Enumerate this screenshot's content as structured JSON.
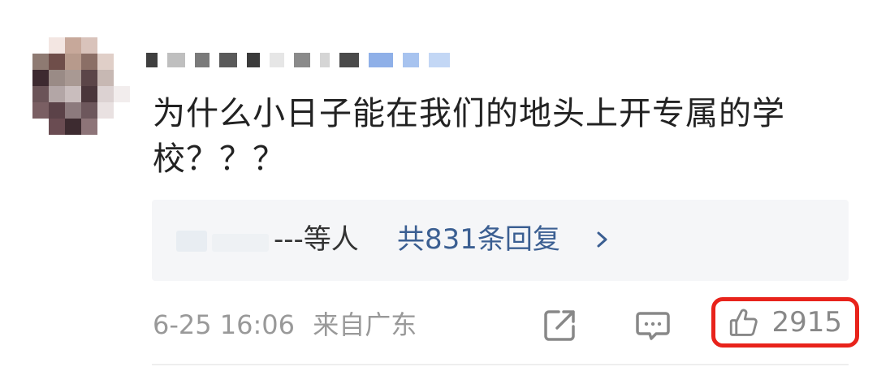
{
  "comment": {
    "text": "为什么小日子能在我们的地头上开专属的学校？？？"
  },
  "replies": {
    "names_suffix": "---等人",
    "summary_link": "共831条回复"
  },
  "meta": {
    "time": "6-25 16:06",
    "location": "来自广东"
  },
  "actions": {
    "share_icon": "share-icon",
    "comment_icon": "comment-icon",
    "like_icon": "thumbs-up-icon",
    "like_count": "2915"
  },
  "colors": {
    "link": "#3b5f92",
    "highlight": "#e8231b",
    "meta_text": "#999999"
  }
}
